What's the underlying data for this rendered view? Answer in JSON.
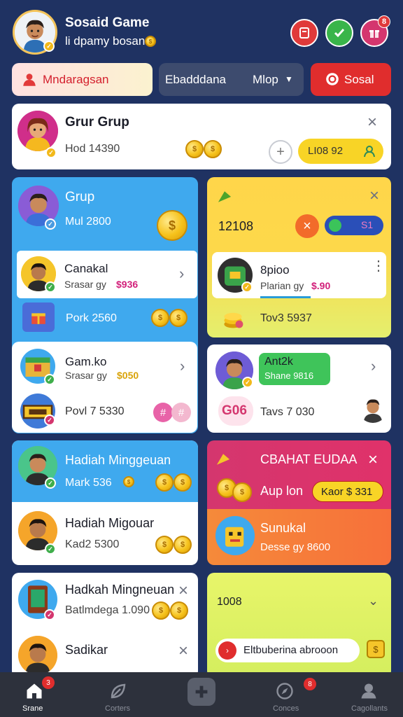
{
  "header": {
    "title": "Sosaid Game",
    "subtitle": "li dpamy bosan",
    "notification_count": "8",
    "colors": {
      "red": "#e03a3a",
      "green": "#39b54a",
      "pink": "#d4366e"
    }
  },
  "tabs": {
    "left": "Mndaragsan",
    "middle": "Ebadddana",
    "middle_select": "Mlop",
    "right": "Sosal"
  },
  "group_card": {
    "title": "Grur Grup",
    "subtitle": "Hod 14390",
    "amount": "LI08 92"
  },
  "left_col": {
    "group": {
      "title": "Grup",
      "sub": "Mul 2800"
    },
    "row1": {
      "name": "Canakal",
      "sub": "Srasar gy",
      "price": "$936"
    },
    "row1_foot": "Pork 2560",
    "row2": {
      "name": "Gam.ko",
      "sub": "Srasar gy",
      "price": "$050"
    },
    "row2_foot": "Povl 7 5330",
    "hadiah": {
      "title": "Hadiah Minggeuan",
      "sub": "Mark 536"
    },
    "hadiah2": {
      "title": "Hadiah Migouar",
      "sub": "Kad2 5300"
    },
    "hadkah": {
      "title": "Hadkah Mingneuan",
      "sub": "Batlmdega 1.090"
    },
    "sadikar": {
      "title": "Sadikar"
    }
  },
  "right_col": {
    "yellow_card": {
      "value": "12108",
      "pill": "S1"
    },
    "row1": {
      "name": "8pioo",
      "sub": "Plarian gy",
      "price": "$.90"
    },
    "row1_foot": "Tov3 5937",
    "row2": {
      "name": "Ant2k",
      "sub": "Shane 9816"
    },
    "row2_badge": "G06",
    "row2_foot": "Tavs 7 030",
    "pink_card": {
      "title": "CBAHAT EUDAA",
      "sub": "Aup lon",
      "btn": "Kaor $ 331"
    },
    "orange_card": {
      "name": "Sunukal",
      "sub": "Desse gy 8600"
    },
    "lime_card": {
      "value": "1008",
      "btn": "Eltbuberina abrooon"
    }
  },
  "bottom_nav": {
    "items": [
      {
        "label": "Srane",
        "badge": "3"
      },
      {
        "label": "Corters",
        "badge": ""
      },
      {
        "label": "",
        "badge": ""
      },
      {
        "label": "Conces",
        "badge": "8"
      },
      {
        "label": "Cagollants",
        "badge": ""
      }
    ]
  }
}
